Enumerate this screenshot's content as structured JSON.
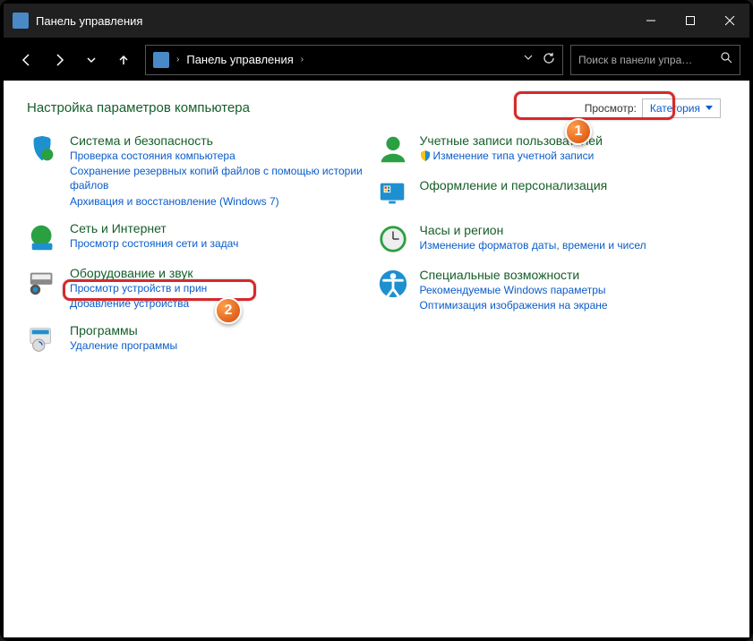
{
  "window": {
    "title": "Панель управления"
  },
  "nav": {
    "breadcrumb_root": "Панель управления",
    "breadcrumb_sep": "›",
    "search_placeholder": "Поиск в панели упра…"
  },
  "header": {
    "title": "Настройка параметров компьютера",
    "viewby_label": "Просмотр:",
    "viewby_value": "Категория"
  },
  "callouts": {
    "badge1": "1",
    "badge2": "2"
  },
  "categories": {
    "left": [
      {
        "name": "Система и безопасность",
        "links": [
          "Проверка состояния компьютера",
          "Сохранение резервных копий файлов с помощью истории файлов",
          "Архивация и восстановление (Windows 7)"
        ]
      },
      {
        "name": "Сеть и Интернет",
        "links": [
          "Просмотр состояния сети и задач"
        ]
      },
      {
        "name": "Оборудование и звук",
        "links": [
          "Просмотр устройств и прин",
          "Добавление устройства"
        ]
      },
      {
        "name": "Программы",
        "links": [
          "Удаление программы"
        ]
      }
    ],
    "right": [
      {
        "name": "Учетные записи пользователей",
        "links": [
          "Изменение типа учетной записи"
        ],
        "shield": [
          true
        ]
      },
      {
        "name": "Оформление и персонализация",
        "links": []
      },
      {
        "name": "Часы и регион",
        "links": [
          "Изменение форматов даты, времени и чисел"
        ]
      },
      {
        "name": "Специальные возможности",
        "links": [
          "Рекомендуемые Windows параметры",
          "Оптимизация изображения на экране"
        ]
      }
    ]
  }
}
